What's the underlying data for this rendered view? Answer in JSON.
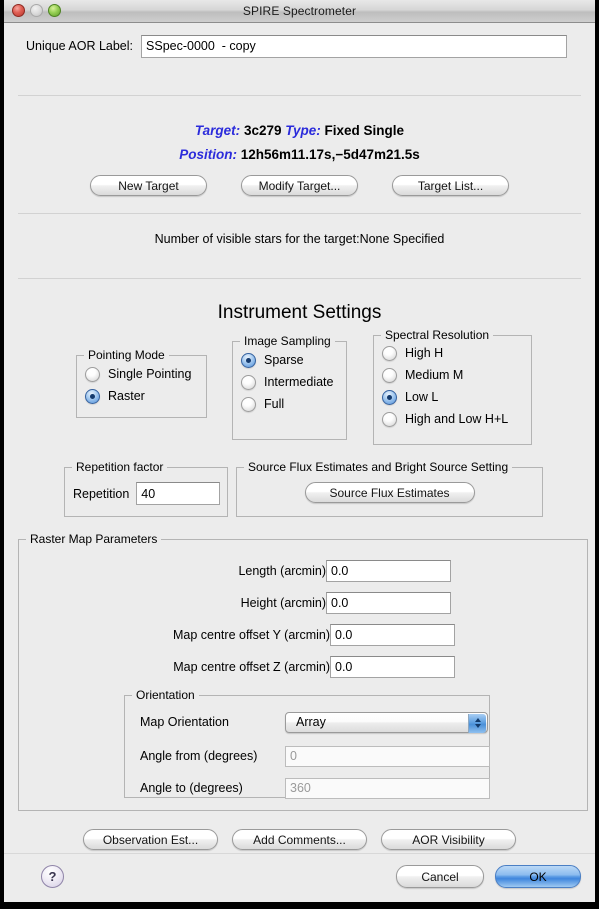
{
  "window": {
    "title": "SPIRE Spectrometer",
    "traffic_lights": [
      "close",
      "minimize",
      "zoom"
    ]
  },
  "aor": {
    "label": "Unique AOR Label:",
    "value": "SSpec-0000  - copy",
    "placeholder": ""
  },
  "target": {
    "target_key": "Target:",
    "target_value": "3c279",
    "type_key": "Type:",
    "type_value": "Fixed Single",
    "position_key": "Position:",
    "position_value": "12h56m11.17s,−5d47m21.5s",
    "buttons": [
      {
        "label": "New Target"
      },
      {
        "label": "Modify Target..."
      },
      {
        "label": "Target List..."
      }
    ],
    "visible_stars_text": "Number of visible stars for the target:None Specified"
  },
  "instrument": {
    "heading": "Instrument Settings",
    "pointing_mode": {
      "title": "Pointing Mode",
      "options": [
        {
          "label": "Single Pointing",
          "selected": false
        },
        {
          "label": "Raster",
          "selected": true
        }
      ]
    },
    "image_sampling": {
      "title": "Image Sampling",
      "options": [
        {
          "label": "Sparse",
          "selected": true
        },
        {
          "label": "Intermediate",
          "selected": false
        },
        {
          "label": "Full",
          "selected": false
        }
      ]
    },
    "spectral_resolution": {
      "title": "Spectral Resolution",
      "options": [
        {
          "label": "High H",
          "selected": false
        },
        {
          "label": "Medium M",
          "selected": false
        },
        {
          "label": "Low L",
          "selected": true
        },
        {
          "label": "High and Low H+L",
          "selected": false
        }
      ]
    },
    "repetition": {
      "title": "Repetition factor",
      "field_label": "Repetition",
      "value": "40"
    },
    "source_flux": {
      "title": "Source Flux Estimates and Bright Source Setting",
      "button_label": "Source Flux Estimates"
    }
  },
  "raster_map": {
    "title": "Raster Map Parameters",
    "fields": [
      {
        "label": "Length (arcmin)",
        "value": "0.0"
      },
      {
        "label": "Height (arcmin)",
        "value": "0.0"
      },
      {
        "label": "Map centre offset Y (arcmin)",
        "value": "0.0"
      },
      {
        "label": "Map centre offset Z (arcmin)",
        "value": "0.0"
      }
    ],
    "orientation": {
      "title": "Orientation",
      "map_orientation_label": "Map Orientation",
      "map_orientation_value": "Array",
      "angle_from_label": "Angle from (degrees)",
      "angle_from_value": "0",
      "angle_to_label": "Angle to (degrees)",
      "angle_to_value": "360"
    }
  },
  "bottom_buttons": [
    {
      "label": "Observation Est..."
    },
    {
      "label": "Add Comments..."
    },
    {
      "label": "AOR Visibility"
    }
  ],
  "footer": {
    "help_label": "?",
    "cancel_label": "Cancel",
    "ok_label": "OK"
  },
  "colors": {
    "accent_blue": "#2b2bdb",
    "default_button_blue": "#3f86dd",
    "window_bg": "#ececec"
  }
}
